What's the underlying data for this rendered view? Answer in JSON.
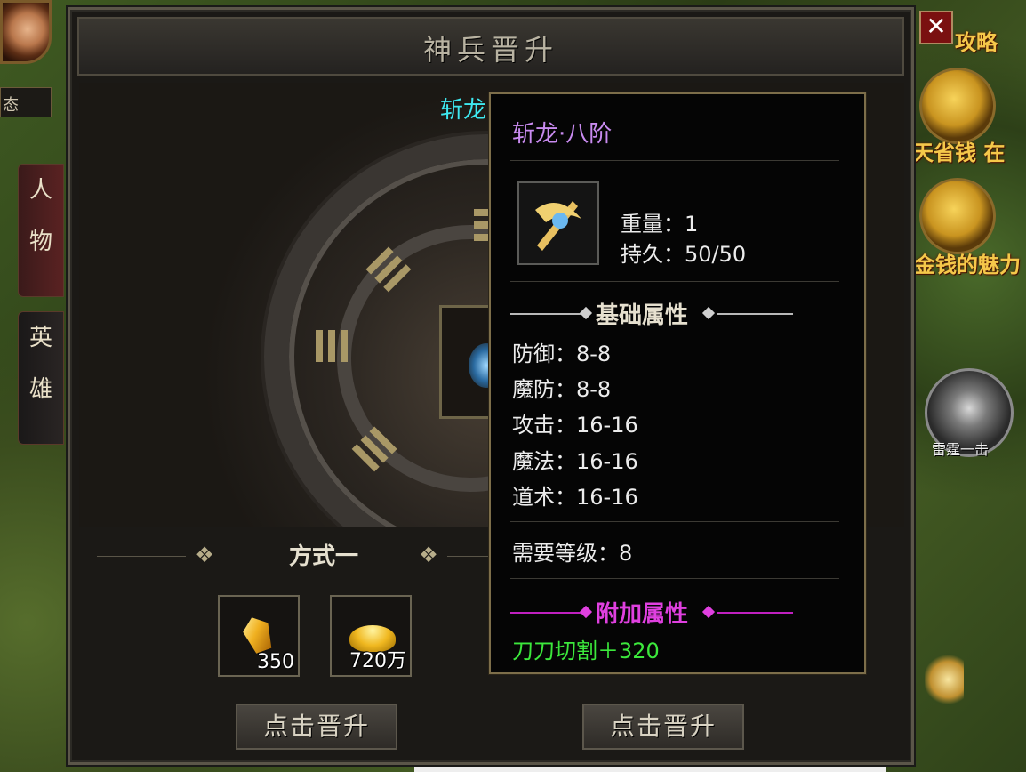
{
  "background": {
    "status_label": "态",
    "side_tabs": [
      {
        "label_1": "人",
        "label_2": "物"
      },
      {
        "label_1": "英",
        "label_2": "雄"
      }
    ],
    "right_strip": {
      "labels": [
        "攻略",
        "天省钱 在",
        "金钱的魅力"
      ],
      "skill_label": "雷霆一击"
    }
  },
  "panel": {
    "title": "神兵晋升",
    "weapon_name": "斩龙",
    "method": {
      "title": "方式一",
      "materials": [
        {
          "icon": "gold-crystal-icon",
          "quantity": "350"
        },
        {
          "icon": "gold-ingot-icon",
          "quantity": "720万"
        }
      ]
    },
    "buttons": [
      "点击晋升",
      "点击晋升"
    ]
  },
  "tooltip": {
    "title": "斩龙·八阶",
    "weight": "重量：1",
    "durability": "持久：50/50",
    "base_section_title": "基础属性",
    "base_stats": [
      "防御：8-8",
      "魔防：8-8",
      "攻击：16-16",
      "魔法：16-16",
      "道术：16-16"
    ],
    "required_level": "需要等级：8",
    "extra_section_title": "附加属性",
    "extra_stats": [
      "刀刀切割＋320"
    ]
  },
  "close_icon": "close-icon",
  "colors": {
    "tooltip_title": "#c98bf0",
    "weapon_name": "#3ee8f0",
    "base_section": "#e6e0cf",
    "extra_section": "#e040e0",
    "extra_stat": "#3ce83c"
  }
}
